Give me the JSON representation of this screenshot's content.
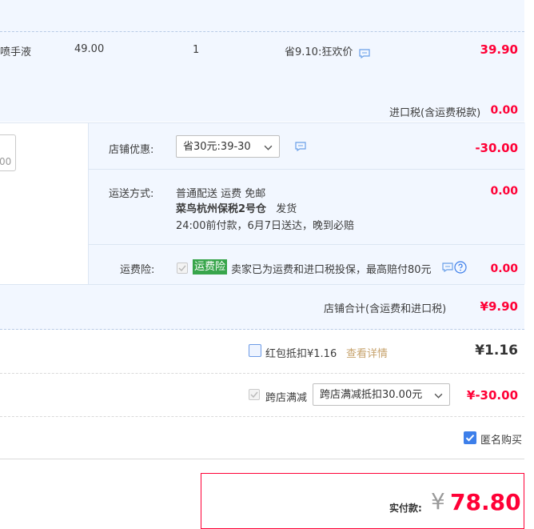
{
  "item": {
    "name": "喷手液",
    "price": "49.00",
    "quantity": "1",
    "promo": "省9.10:狂欢价",
    "subtotal": "39.90"
  },
  "import_tax": {
    "label": "进口税(含运费税款)",
    "value": "0.00"
  },
  "left_input_fragment": "00",
  "shop_discount": {
    "label": "店铺优惠:",
    "selected": "省30元:39-30",
    "value": "-30.00"
  },
  "shipping": {
    "label": "运送方式:",
    "line1": "普通配送 运费 免邮",
    "warehouse": "菜鸟杭州保税2号仓",
    "ship_note": "发货",
    "line3": "24:00前付款，6月7日送达，晚到必赔",
    "value": "0.00"
  },
  "freight_insurance": {
    "label": "运费险:",
    "badge": "运费险",
    "text": "卖家已为运费和进口税投保，最高赔付80元",
    "value": "0.00"
  },
  "shop_total": {
    "label": "店铺合计(含运费和进口税)",
    "value": "¥9.90"
  },
  "red_packet": {
    "label": "红包抵扣¥1.16",
    "details_link": "查看详情",
    "value": "¥1.16"
  },
  "cross_store": {
    "label": "跨店满减",
    "selected": "跨店满减抵扣30.00元",
    "value": "¥-30.00"
  },
  "anonymous": {
    "label": "匿名购买",
    "checked": true
  },
  "payment": {
    "label": "实付款:",
    "currency": "¥",
    "amount": "78.80"
  },
  "colors": {
    "accent_red": "#ff0036",
    "band_blue": "#f2f7ff",
    "badge_green": "#38a54b",
    "check_blue": "#3d7fea"
  }
}
